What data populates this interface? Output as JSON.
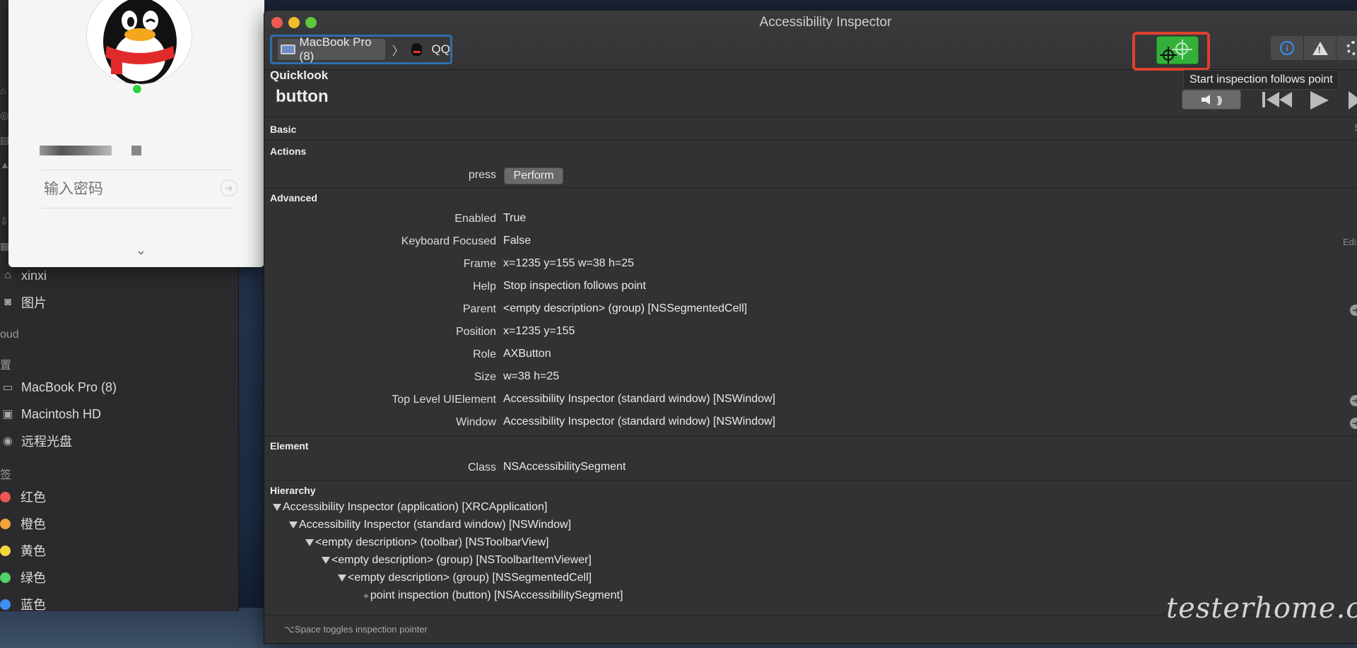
{
  "finder_sidebar": {
    "items_top": [
      {
        "label": "xinxi",
        "icon": "home-icon"
      },
      {
        "label": "图片",
        "icon": "camera-icon"
      }
    ],
    "icloud_heading": "oud",
    "locations_heading": "置",
    "locations": [
      {
        "label": "MacBook Pro (8)",
        "icon": "laptop-icon"
      },
      {
        "label": "Macintosh HD",
        "icon": "disk-icon"
      },
      {
        "label": "远程光盘",
        "icon": "disc-icon"
      }
    ],
    "tags_heading": "签",
    "tags": [
      {
        "label": "红色",
        "color": "#f05555"
      },
      {
        "label": "橙色",
        "color": "#f2a33a"
      },
      {
        "label": "黄色",
        "color": "#f3d83c"
      },
      {
        "label": "绿色",
        "color": "#52d26b"
      },
      {
        "label": "蓝色",
        "color": "#3e8ef5"
      }
    ]
  },
  "qq_login": {
    "password_placeholder": "输入密码",
    "pw_arrow": "➜",
    "chevron": "⌄"
  },
  "inspector": {
    "window_title": "Accessibility Inspector",
    "target": {
      "device": "MacBook Pro (8)",
      "separator": "〉",
      "app": "QQ"
    },
    "tooltip": "Start inspection follows point",
    "quicklook": {
      "title": "Quicklook",
      "value": "button"
    },
    "sections": {
      "basic": "Basic",
      "actions": "Actions",
      "advanced": "Advanced",
      "element": "Element",
      "hierarchy": "Hierarchy"
    },
    "basic_trailing": "S",
    "action": {
      "name": "press",
      "button": "Perform"
    },
    "edit_label": "Edi",
    "advanced": [
      {
        "key": "Enabled",
        "value": "True"
      },
      {
        "key": "Keyboard Focused",
        "value": "False"
      },
      {
        "key": "Frame",
        "value": "x=1235 y=155 w=38 h=25"
      },
      {
        "key": "Help",
        "value": "Stop inspection follows point"
      },
      {
        "key": "Parent",
        "value": "<empty description> (group) [NSSegmentedCell]"
      },
      {
        "key": "Position",
        "value": "x=1235 y=155"
      },
      {
        "key": "Role",
        "value": "AXButton"
      },
      {
        "key": "Size",
        "value": "w=38 h=25"
      },
      {
        "key": "Top Level UIElement",
        "value": "Accessibility Inspector (standard window) [NSWindow]"
      },
      {
        "key": "Window",
        "value": "Accessibility Inspector (standard window) [NSWindow]"
      }
    ],
    "element": {
      "key": "Class",
      "value": "NSAccessibilitySegment"
    },
    "hierarchy": [
      "Accessibility Inspector (application) [XRCApplication]",
      "Accessibility Inspector (standard window) [NSWindow]",
      "<empty description> (toolbar) [NSToolbarView]",
      "<empty description> (group) [NSToolbarItemViewer]",
      "<empty description> (group) [NSSegmentedCell]",
      "point inspection (button) [NSAccessibilitySegment]"
    ],
    "footer_hint": "⌥Space toggles inspection pointer",
    "goto_glyph": "➜",
    "leaf_glyph": "⌖",
    "waves_glyph": ")))"
  },
  "watermark": "testerhome.com",
  "colors": {
    "highlight_red": "#e0402b",
    "inspect_green": "#34b03a",
    "target_border": "#2f6ea8",
    "info_blue": "#3a8ff0"
  }
}
